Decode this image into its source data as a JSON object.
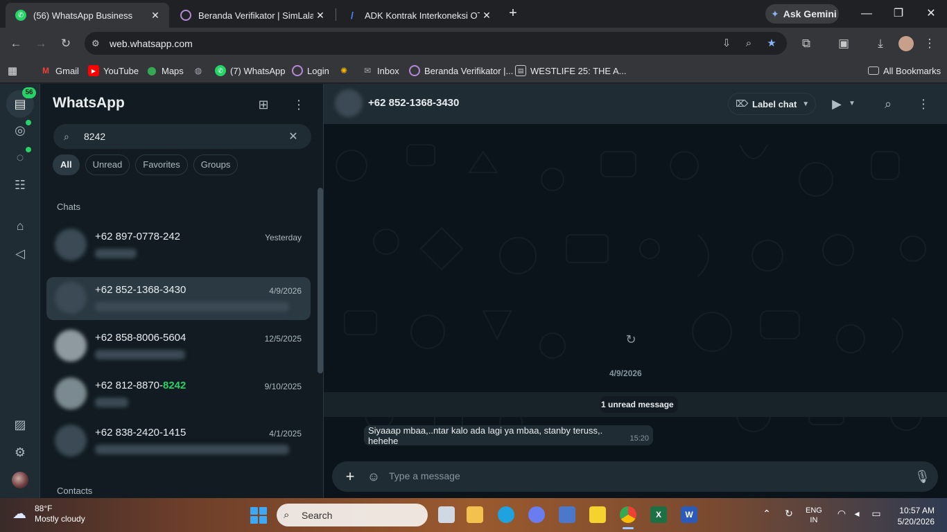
{
  "browser": {
    "tabs": [
      {
        "title": "(56) WhatsApp Business",
        "favicon": "whatsapp-icon",
        "active": true
      },
      {
        "title": "Beranda Verifikator | SimLala",
        "favicon": "simlala-icon",
        "active": false
      },
      {
        "title": "ADK Kontrak Interkoneksi OTP I",
        "favicon": "adk-icon",
        "active": false
      }
    ],
    "new_tab": "+",
    "ask_gemini": "Ask Gemini",
    "url": "web.whatsapp.com",
    "bookmarks": [
      {
        "label": "Gmail",
        "icon": "gmail-icon"
      },
      {
        "label": "YouTube",
        "icon": "youtube-icon"
      },
      {
        "label": "Maps",
        "icon": "maps-icon"
      },
      {
        "label": "",
        "icon": "globe-icon"
      },
      {
        "label": "(7) WhatsApp",
        "icon": "whatsapp-icon"
      },
      {
        "label": "Login",
        "icon": "login-icon"
      },
      {
        "label": "",
        "icon": "pinwheel-icon"
      },
      {
        "label": "Inbox",
        "icon": "inbox-icon"
      },
      {
        "label": "Beranda Verifikator |...",
        "icon": "simlala-icon"
      },
      {
        "label": "WESTLIFE 25: THE A...",
        "icon": "page-icon"
      }
    ],
    "all_bookmarks": "All Bookmarks"
  },
  "whatsapp": {
    "rail": {
      "chats_badge": "56"
    },
    "sidebar": {
      "title": "WhatsApp",
      "search_value": "8242",
      "filters": [
        "All",
        "Unread",
        "Favorites",
        "Groups"
      ],
      "section_chats": "Chats",
      "section_contacts": "Contacts",
      "chats": [
        {
          "name": "+62 897-0778-242",
          "date": "Yesterday",
          "selected": false
        },
        {
          "name": "+62 852-1368-3430",
          "date": "4/9/2026",
          "selected": true
        },
        {
          "name": "+62 858-8006-5604",
          "date": "12/5/2025",
          "selected": false
        },
        {
          "name_prefix": "+62 812-8870-",
          "name_highlight": "8242",
          "date": "9/10/2025",
          "selected": false
        },
        {
          "name": "+62 838-2420-1415",
          "date": "4/1/2025",
          "selected": false
        }
      ]
    },
    "conversation": {
      "contact": "+62 852-1368-3430",
      "label_chat": "Label chat",
      "date_pill": "4/9/2026",
      "unread_notice": "1 unread message",
      "message": {
        "text": "Siyaaap mbaa,..ntar kalo ada lagi ya mbaa, stanby teruss,. hehehe",
        "time": "15:20"
      },
      "composer_placeholder": "Type a message"
    },
    "colors": {
      "accent": "#25d366",
      "panel": "#202c33",
      "background": "#0b141a"
    }
  },
  "taskbar": {
    "weather_temp": "88°F",
    "weather_desc": "Mostly cloudy",
    "search_label": "Search",
    "lang_top": "ENG",
    "lang_bottom": "IN",
    "time": "10:57 AM",
    "date": "5/20/2026"
  }
}
